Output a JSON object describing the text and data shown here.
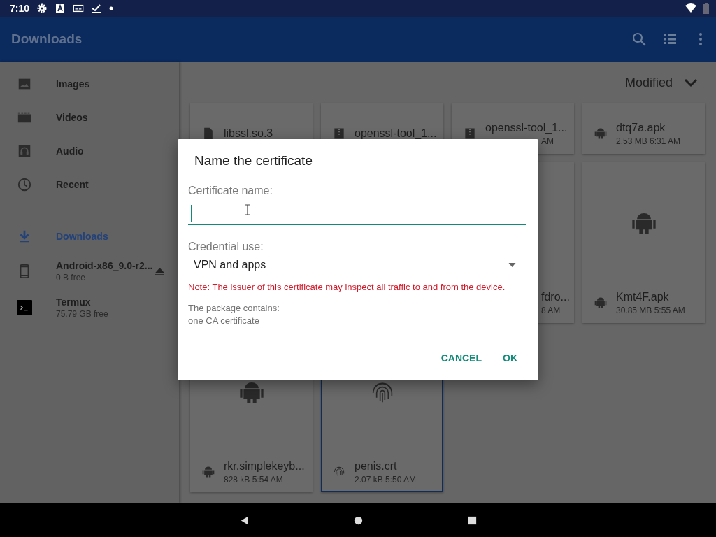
{
  "status_bar": {
    "time": "7:10"
  },
  "app_bar": {
    "title": "Downloads"
  },
  "sidebar": {
    "items": [
      {
        "label": "Images",
        "kind": "images",
        "selected": false
      },
      {
        "label": "Videos",
        "kind": "videos",
        "selected": false
      },
      {
        "label": "Audio",
        "kind": "audio",
        "selected": false
      },
      {
        "label": "Recent",
        "kind": "recent",
        "selected": false
      }
    ],
    "roots": [
      {
        "label": "Downloads",
        "kind": "downloads",
        "selected": true
      },
      {
        "label": "Android-x86_9.0-r2...",
        "subtitle": "0 B free",
        "kind": "device",
        "eject": true,
        "selected": false
      },
      {
        "label": "Termux",
        "subtitle": "75.79 GB free",
        "kind": "terminal",
        "eject": false,
        "selected": false
      }
    ]
  },
  "sort": {
    "label": "Modified"
  },
  "rows": [
    [
      {
        "name": "libssl.so.3",
        "kind": "doc",
        "name_covered": false,
        "selected": false
      },
      {
        "name": "openssl-tool_1...",
        "kind": "zip",
        "name_covered": false,
        "selected": false
      },
      {
        "name": "openssl-tool_1...",
        "meta": "AM",
        "kind": "zip",
        "name_covered": false,
        "meta_covered": true,
        "selected": false
      },
      {
        "name": "dtq7a.apk",
        "meta": "2.53 MB 6:31 AM",
        "kind": "apk",
        "name_covered": false,
        "meta_covered": false,
        "selected": false
      }
    ],
    [
      null,
      null,
      {
        "name": "fdro...",
        "meta": "8 AM",
        "name_covered": true,
        "meta_covered": true,
        "selected": false
      },
      {
        "name": "Kmt4F.apk",
        "meta": "30.85 MB 5:55 AM",
        "kind": "apk",
        "name_covered": false,
        "meta_covered": false,
        "selected": false
      }
    ],
    [
      {
        "name": "rkr.simplekeyb...",
        "meta": "828 kB 5:54 AM",
        "kind": "apk",
        "name_covered": false,
        "meta_covered": false,
        "selected": false
      },
      {
        "name": "penis.crt",
        "meta": "2.07 kB 5:50 AM",
        "kind": "cert",
        "name_covered": false,
        "meta_covered": false,
        "selected": true
      },
      null,
      null
    ]
  ],
  "dialog": {
    "title": "Name the certificate",
    "name_label": "Certificate name:",
    "use_label": "Credential use:",
    "use_value": "VPN and apps",
    "note": "Note: The issuer of this certificate may inspect all traffic to and from the device.",
    "info": [
      "The package contains:",
      "one CA certificate"
    ],
    "buttons": [
      "CANCEL",
      "OK"
    ]
  }
}
